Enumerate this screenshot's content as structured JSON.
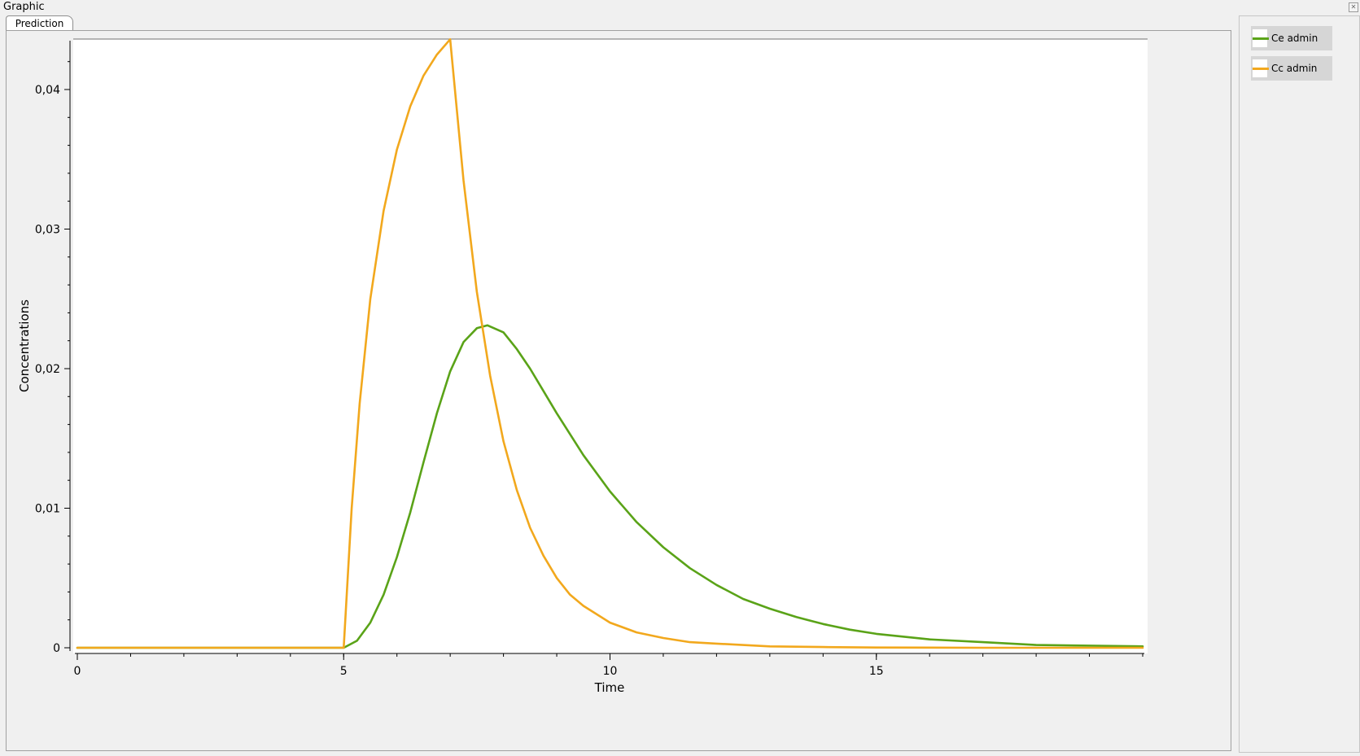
{
  "window": {
    "title": "Graphic",
    "close_icon": "close-icon"
  },
  "tabs": [
    {
      "label": "Prediction",
      "active": true
    }
  ],
  "colors": {
    "ce": "#5aa318",
    "cc": "#f2a81d",
    "plot_bg": "#ffffff",
    "panel_bg": "#f0f0f0"
  },
  "legend": [
    {
      "label": "Ce admin",
      "color": "#5aa318"
    },
    {
      "label": "Cc admin",
      "color": "#f2a81d"
    }
  ],
  "chart_data": {
    "type": "line",
    "title": "",
    "xlabel": "Time",
    "ylabel": "Concentrations",
    "xlim": [
      0,
      20
    ],
    "ylim": [
      0,
      0.044
    ],
    "x_ticks": [
      0,
      5,
      10,
      15
    ],
    "x_tick_labels": [
      "0",
      "5",
      "10",
      "15"
    ],
    "y_ticks": [
      0,
      0.01,
      0.02,
      0.03,
      0.04
    ],
    "y_tick_labels": [
      "0",
      "0,01",
      "0,02",
      "0,03",
      "0,04"
    ],
    "grid": false,
    "legend_placement": "right-side panel",
    "series": [
      {
        "name": "Ce admin",
        "color": "#5aa318",
        "x": [
          0,
          5,
          5.25,
          5.5,
          5.75,
          6,
          6.25,
          6.5,
          6.75,
          7,
          7.25,
          7.5,
          7.7,
          8,
          8.25,
          8.5,
          8.75,
          9,
          9.5,
          10,
          10.5,
          11,
          11.5,
          12,
          12.5,
          13,
          13.5,
          14,
          14.5,
          15,
          16,
          17,
          18,
          19,
          20
        ],
        "y": [
          0,
          0,
          0.0005,
          0.0018,
          0.0038,
          0.0065,
          0.0097,
          0.0133,
          0.0168,
          0.0198,
          0.0219,
          0.0229,
          0.0231,
          0.0226,
          0.0214,
          0.02,
          0.0184,
          0.0168,
          0.0138,
          0.0112,
          0.009,
          0.0072,
          0.0057,
          0.0045,
          0.0035,
          0.0028,
          0.0022,
          0.0017,
          0.0013,
          0.001,
          0.0006,
          0.0004,
          0.0002,
          0.00015,
          0.0001
        ]
      },
      {
        "name": "Cc admin",
        "color": "#f2a81d",
        "x": [
          0,
          5,
          5.15,
          5.3,
          5.5,
          5.75,
          6,
          6.25,
          6.5,
          6.75,
          7,
          7.25,
          7.5,
          7.75,
          8,
          8.25,
          8.5,
          8.75,
          9,
          9.25,
          9.5,
          10,
          10.5,
          11,
          11.5,
          12,
          13,
          14,
          15,
          17,
          20
        ],
        "y": [
          0,
          0,
          0.01,
          0.0175,
          0.025,
          0.0313,
          0.0357,
          0.0388,
          0.041,
          0.0425,
          0.0436,
          0.0335,
          0.0255,
          0.0195,
          0.0148,
          0.0113,
          0.0086,
          0.0066,
          0.005,
          0.0038,
          0.003,
          0.0018,
          0.0011,
          0.0007,
          0.0004,
          0.0003,
          0.0001,
          5e-05,
          2e-05,
          0,
          0
        ]
      }
    ]
  }
}
